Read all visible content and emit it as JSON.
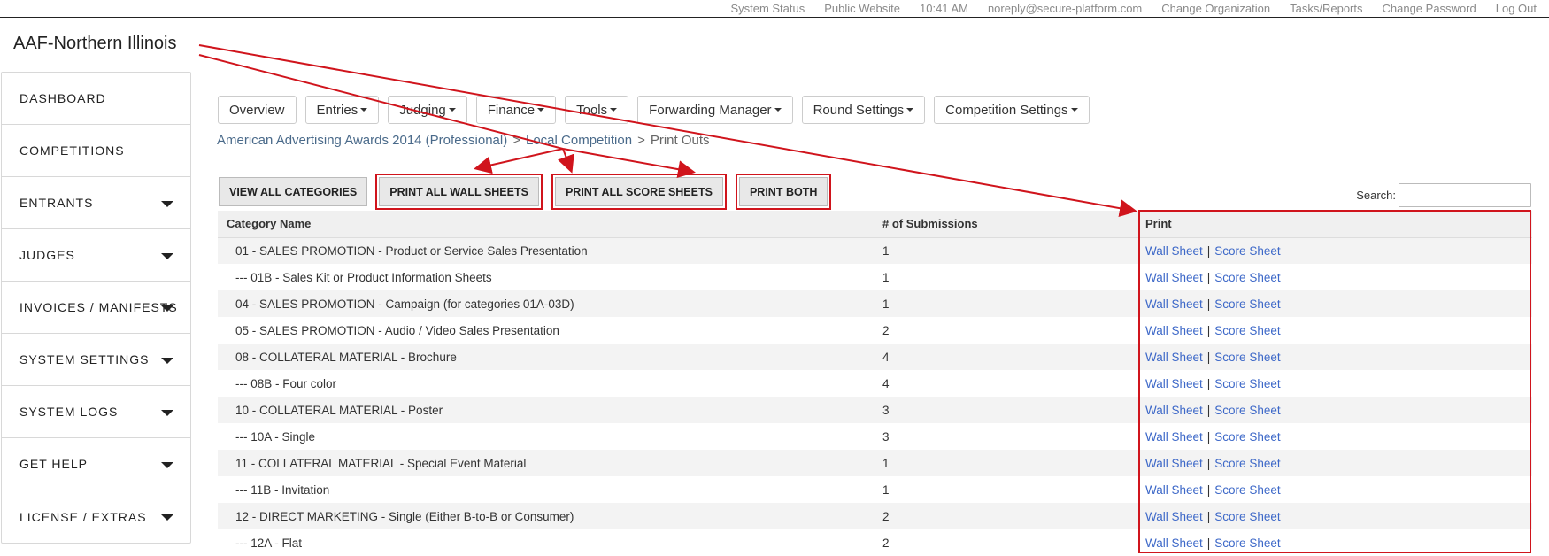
{
  "topbar": {
    "links": [
      "System Status",
      "Public Website",
      "10:41 AM",
      "noreply@secure-platform.com",
      "Change Organization",
      "Tasks/Reports",
      "Change Password",
      "Log Out"
    ]
  },
  "org": {
    "title": "AAF-Northern Illinois"
  },
  "sidebar": {
    "items": [
      {
        "label": "DASHBOARD",
        "has_caret": false
      },
      {
        "label": "COMPETITIONS",
        "has_caret": false
      },
      {
        "label": "ENTRANTS",
        "has_caret": true
      },
      {
        "label": "JUDGES",
        "has_caret": true
      },
      {
        "label": "INVOICES / MANIFESTS",
        "has_caret": true
      },
      {
        "label": "SYSTEM SETTINGS",
        "has_caret": true
      },
      {
        "label": "SYSTEM LOGS",
        "has_caret": true
      },
      {
        "label": "GET HELP",
        "has_caret": true
      },
      {
        "label": "LICENSE / EXTRAS",
        "has_caret": true
      }
    ]
  },
  "tabs": [
    {
      "label": "Overview",
      "dropdown": false
    },
    {
      "label": "Entries",
      "dropdown": true
    },
    {
      "label": "Judging",
      "dropdown": true
    },
    {
      "label": "Finance",
      "dropdown": true
    },
    {
      "label": "Tools",
      "dropdown": true
    },
    {
      "label": "Forwarding Manager",
      "dropdown": true
    },
    {
      "label": "Round Settings",
      "dropdown": true
    },
    {
      "label": "Competition Settings",
      "dropdown": true
    }
  ],
  "breadcrumb": {
    "competition": "American Advertising Awards 2014 (Professional)",
    "round": "Local Competition",
    "page": "Print Outs",
    "separator": ">"
  },
  "actions": {
    "view_all": "VIEW ALL CATEGORIES",
    "print_wall": "PRINT ALL WALL SHEETS",
    "print_score": "PRINT ALL SCORE SHEETS",
    "print_both": "PRINT BOTH"
  },
  "search": {
    "label": "Search:",
    "value": ""
  },
  "table": {
    "headers": [
      "Category Name",
      "# of Submissions",
      "Print"
    ],
    "wall_label": "Wall Sheet",
    "score_label": "Score Sheet",
    "pipe": "|",
    "rows": [
      {
        "name": "01 - SALES PROMOTION - Product or Service Sales Presentation",
        "count": "1"
      },
      {
        "name": "--- 01B - Sales Kit or Product Information Sheets",
        "count": "1"
      },
      {
        "name": "04 - SALES PROMOTION - Campaign (for categories 01A-03D)",
        "count": "1"
      },
      {
        "name": "05 - SALES PROMOTION - Audio / Video Sales Presentation",
        "count": "2"
      },
      {
        "name": "08 - COLLATERAL MATERIAL - Brochure",
        "count": "4"
      },
      {
        "name": "--- 08B - Four color",
        "count": "4"
      },
      {
        "name": "10 - COLLATERAL MATERIAL - Poster",
        "count": "3"
      },
      {
        "name": "--- 10A - Single",
        "count": "3"
      },
      {
        "name": "11 - COLLATERAL MATERIAL - Special Event Material",
        "count": "1"
      },
      {
        "name": "--- 11B - Invitation",
        "count": "1"
      },
      {
        "name": "12 - DIRECT MARKETING - Single (Either B-to-B or Consumer)",
        "count": "2"
      },
      {
        "name": "--- 12A - Flat",
        "count": "2"
      }
    ]
  },
  "colors": {
    "annotation": "#d0141c",
    "link": "#3d68c8",
    "breadcrumb_link": "#4a6a8a"
  }
}
